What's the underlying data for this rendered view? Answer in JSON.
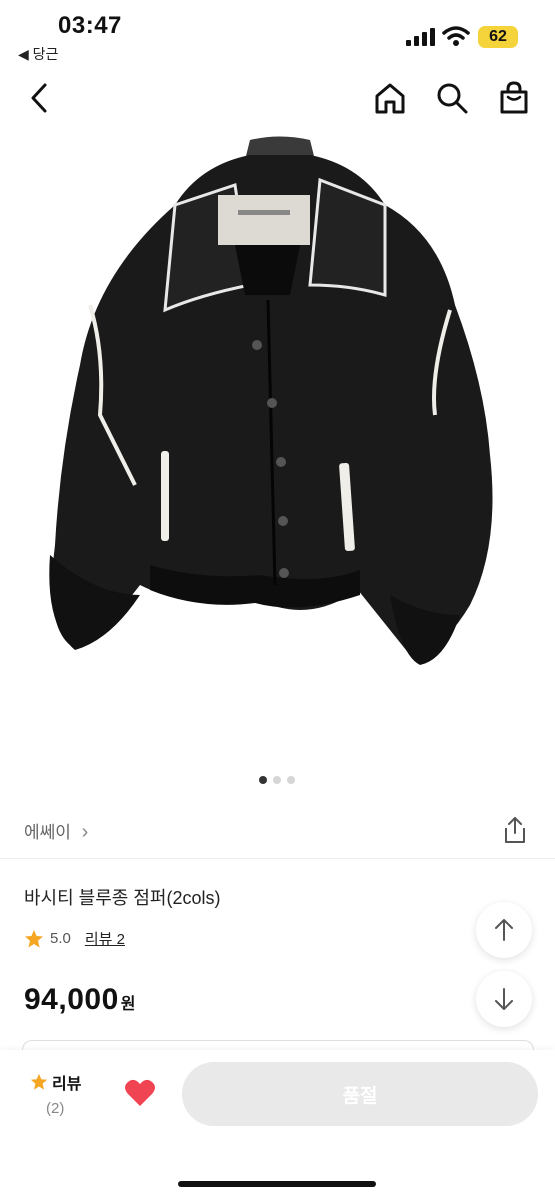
{
  "status": {
    "time": "03:47",
    "back_app": "◀ 당근",
    "battery": "62"
  },
  "brand": {
    "name": "에쎄이",
    "chevron": "›"
  },
  "product": {
    "title": "바시티 블루종 점퍼(2cols)",
    "rating": "5.0",
    "review_link": "리뷰 2",
    "price": "94,000",
    "price_unit": "원"
  },
  "carousel": {
    "count": 3,
    "active": 0
  },
  "bottom_bar": {
    "review_label": "리뷰",
    "review_count": "(2)",
    "soldout_label": "품절"
  },
  "colors": {
    "star": "#f5a623",
    "heart": "#f04452",
    "battery": "#f5d33b"
  },
  "icons": [
    "back-icon",
    "home-icon",
    "search-icon",
    "bag-icon",
    "share-icon",
    "arrow-up-icon",
    "arrow-down-icon",
    "star-icon",
    "heart-icon"
  ]
}
